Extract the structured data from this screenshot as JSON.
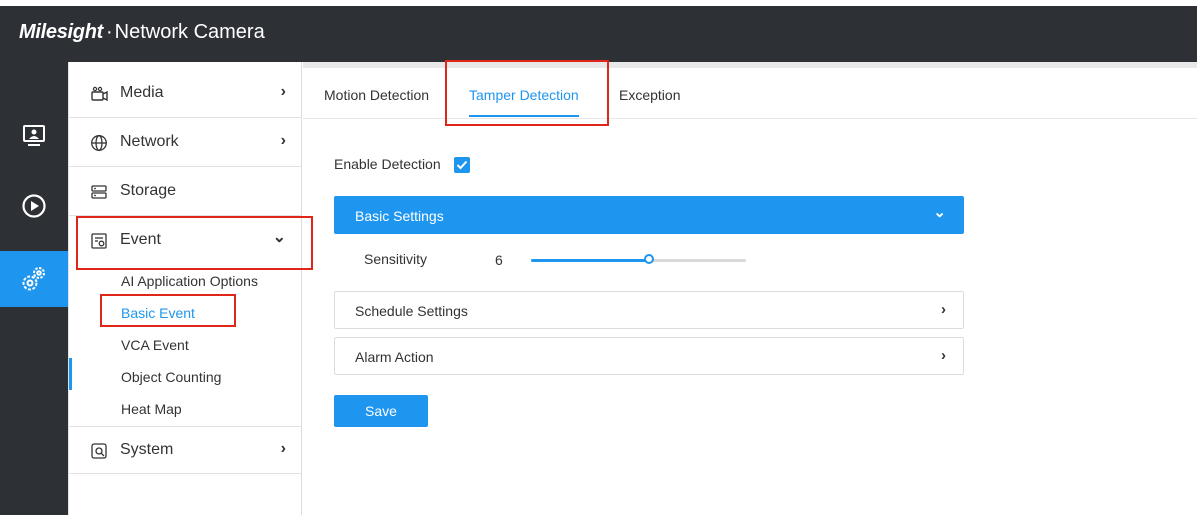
{
  "app": {
    "brand": "Milesight",
    "title": "Network Camera"
  },
  "rail": {
    "icons": [
      "monitor-icon",
      "playback-icon",
      "settings-icon"
    ],
    "active": "settings-icon"
  },
  "sidebar": {
    "items": [
      {
        "label": "Media",
        "chevron": "›"
      },
      {
        "label": "Network",
        "chevron": "›"
      },
      {
        "label": "Storage",
        "chevron": ""
      },
      {
        "label": "Event",
        "chevron": "⌄"
      },
      {
        "label": "System",
        "chevron": "›"
      }
    ],
    "event_subitems": [
      "AI Application Options",
      "Basic Event",
      "VCA Event",
      "Object Counting",
      "Heat Map"
    ],
    "active_subitem": "Basic Event"
  },
  "tabs": [
    "Motion Detection",
    "Tamper Detection",
    "Exception"
  ],
  "active_tab": "Tamper Detection",
  "form": {
    "enable_label": "Enable Detection",
    "enable_checked": true,
    "basic_settings": "Basic Settings",
    "sensitivity_label": "Sensitivity",
    "sensitivity_value": "6",
    "sensitivity_fraction": 0.55,
    "schedule_settings": "Schedule Settings",
    "alarm_action": "Alarm Action",
    "save_label": "Save"
  },
  "colors": {
    "accent": "#1e96f0",
    "dark": "#2d3035",
    "highlight": "#e0251b"
  }
}
